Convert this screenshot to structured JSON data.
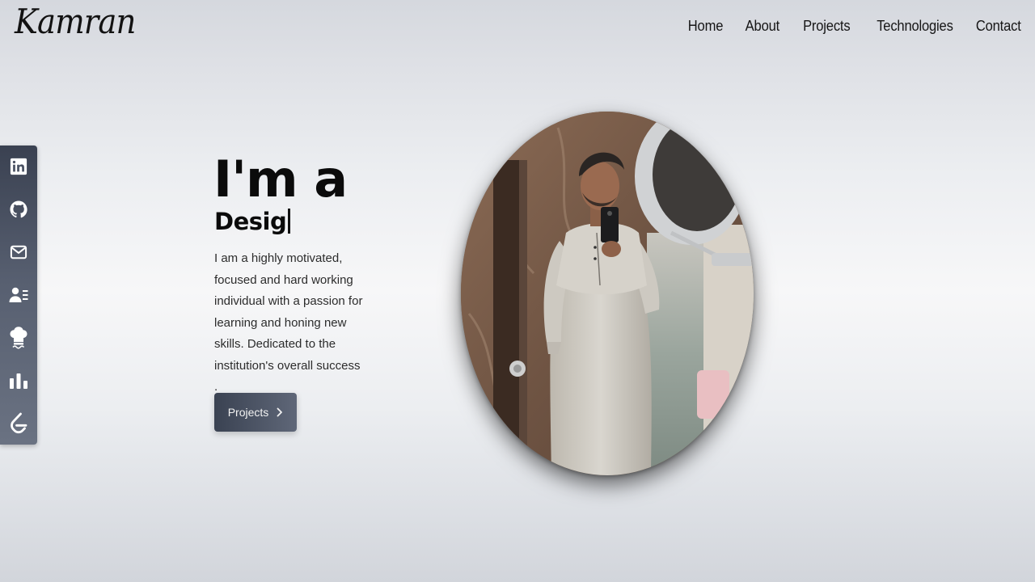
{
  "brand": {
    "logo_text": "Kamran"
  },
  "nav": {
    "items": [
      {
        "label": "Home"
      },
      {
        "label": "About"
      },
      {
        "label": "Projects"
      },
      {
        "label": "Technologies"
      },
      {
        "label": "Contact"
      }
    ]
  },
  "social": {
    "items": [
      {
        "icon": "linkedin-icon"
      },
      {
        "icon": "github-icon"
      },
      {
        "icon": "mail-icon"
      },
      {
        "icon": "resume-icon"
      },
      {
        "icon": "chef-hat-icon"
      },
      {
        "icon": "bar-chart-icon"
      },
      {
        "icon": "leetcode-icon"
      }
    ]
  },
  "hero": {
    "title": "I'm a",
    "typed_text": "Desig",
    "description": "I am a highly motivated, focused and hard working individual with a passion for learning and honing new skills. Dedicated to the institution's overall success .",
    "cta_label": "Projects"
  },
  "colors": {
    "sidebar": "#4a5263",
    "button": "#3a4252",
    "text": "#0b0b0b"
  }
}
